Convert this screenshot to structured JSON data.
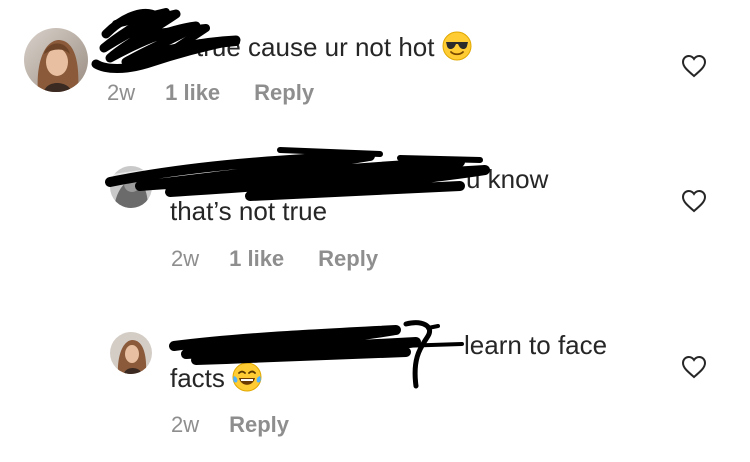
{
  "comments": [
    {
      "text": "true cause ur not hot",
      "emoji": "sunglasses-emoji",
      "time": "2w",
      "likes": "1 like",
      "reply": "Reply"
    },
    {
      "mention_tail": "u",
      "text": "u know",
      "text2": "that’s not true",
      "time": "2w",
      "likes": "1 like",
      "reply": "Reply"
    },
    {
      "text": "learn to face",
      "text2": "facts",
      "emoji": "tears-of-joy-emoji",
      "time": "2w",
      "reply": "Reply"
    }
  ],
  "colors": {
    "text": "#262626",
    "meta": "#8e8e8e",
    "mention": "#00376b",
    "redaction": "#000000"
  },
  "icons": {
    "like": "heart-outline-icon"
  }
}
